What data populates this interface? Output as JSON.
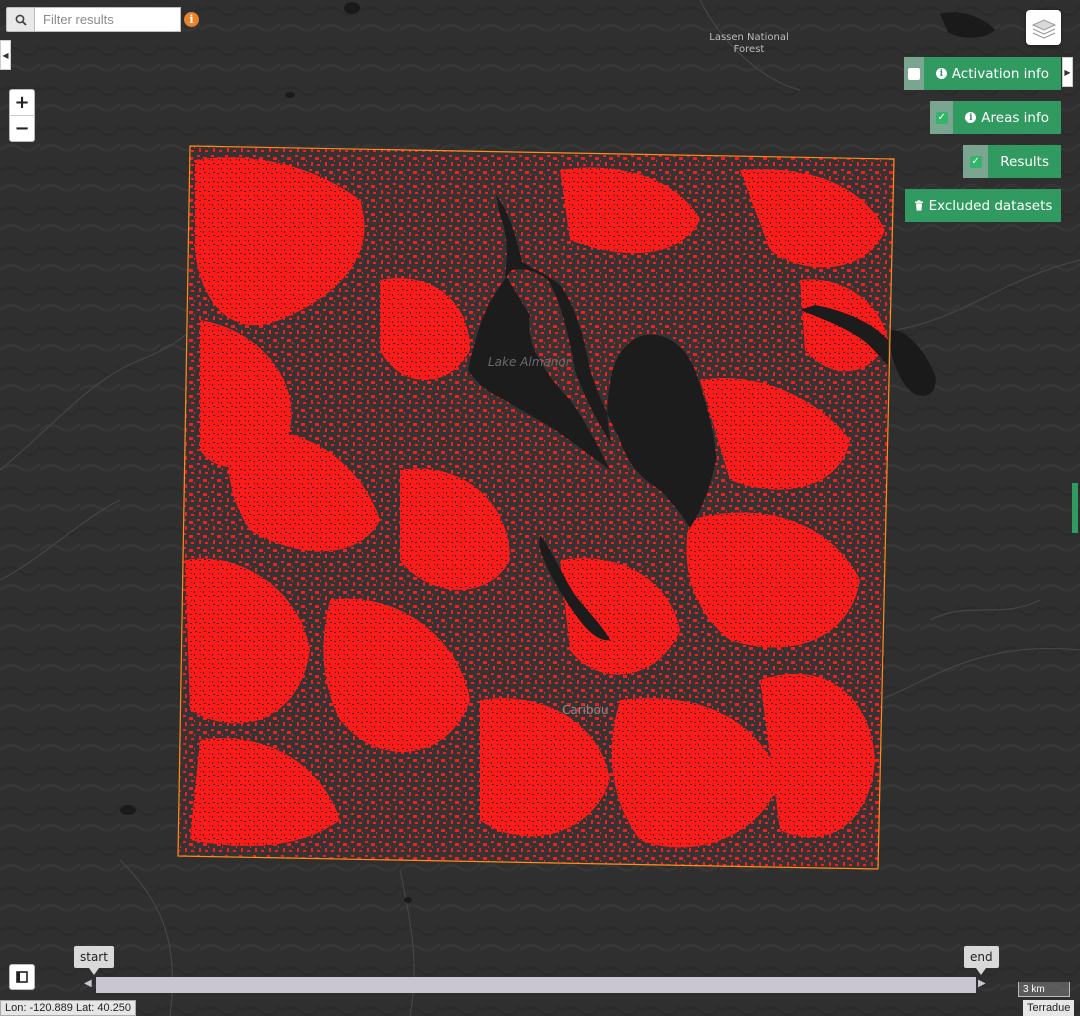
{
  "search": {
    "placeholder": "Filter results",
    "icon": "search-icon",
    "info_icon": "info-circle-icon"
  },
  "zoom": {
    "in_label": "+",
    "out_label": "−"
  },
  "layers_button": {
    "icon": "layers-icon"
  },
  "panel": {
    "activation": {
      "label": "Activation info",
      "checked": false
    },
    "areas": {
      "label": "Areas info",
      "checked": true
    },
    "results": {
      "label": "Results",
      "checked": true
    },
    "excluded": {
      "label": "Excluded datasets",
      "icon": "trash-icon"
    }
  },
  "map_labels": {
    "lassen_line1": "Lassen National",
    "lassen_line2": "Forest",
    "lake": "Lake Almanor",
    "town": "Caribou"
  },
  "timeline": {
    "start_label": "start",
    "end_label": "end"
  },
  "footer": {
    "coords": "Lon: -120.889 Lat: 40.250",
    "scale": "3 km",
    "attribution": "Terradue"
  },
  "colors": {
    "accent_green": "#319a60",
    "result_red": "#ff1a1a",
    "footprint_orange": "#ff8c1a",
    "water": "#1b1c1b",
    "basemap": "#2f2f2f"
  }
}
